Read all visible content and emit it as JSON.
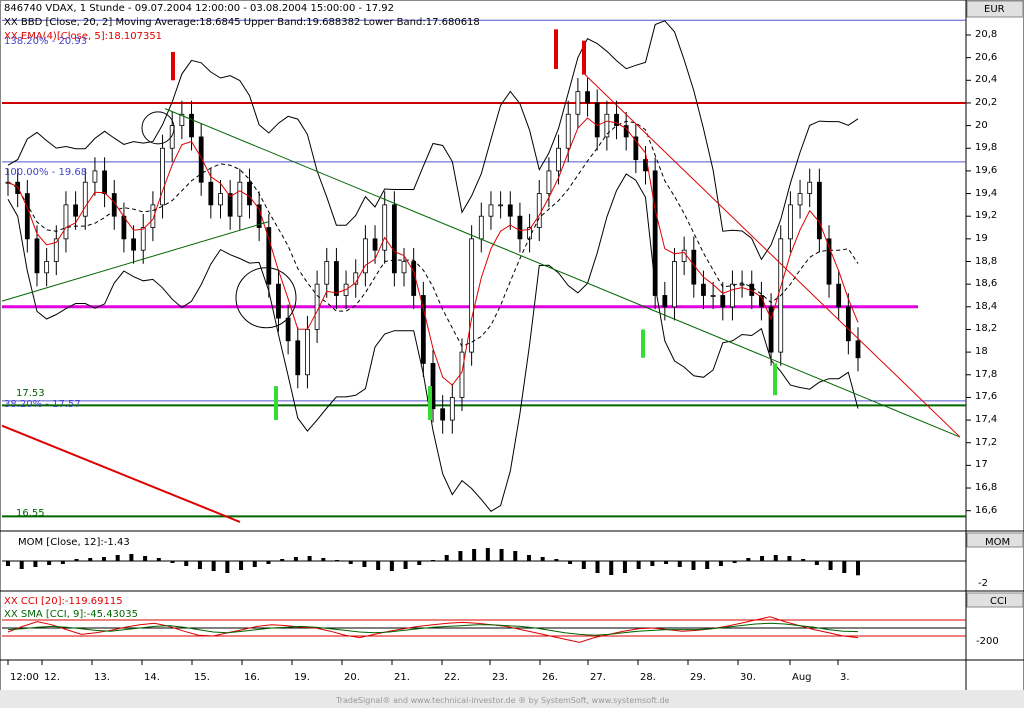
{
  "header": {
    "title": "846740  VDAX, 1 Stunde - 09.07.2004 12:00:00 - 03.08.2004 15:00:00 - 17.92",
    "bbd_label": "XX BBD [Close, 20, 2] Moving Average:18.6845 Upper Band:19.688382 Lower Band:17.680618",
    "ema_label": "XX EMA(4)[Close, 5]:18.107351",
    "currency": "EUR",
    "fib_top": "138.20% - 20.93",
    "fib_mid": "100.00% - 19.68",
    "fib_low": "38.20% - 17.57",
    "level_1753": "17.53",
    "level_1655": "16.55"
  },
  "mom_panel": {
    "label": "MOM [Close, 12]:-1.43",
    "title": "MOM",
    "tick": "-2"
  },
  "cci_panel": {
    "label1": "XX CCI [20]:-119.69115",
    "label2": "XX SMA [CCI, 9]:-45.43035",
    "title": "CCI",
    "tick": "-200"
  },
  "footer": "TradeSignal® and www.technical-investor.de ® by SystemSoft, www.systemsoft.de",
  "colors": {
    "red": "#dd0000",
    "magenta": "#e000e0",
    "green": "#006600",
    "bright_green": "#33dd33",
    "blue": "#4444cc"
  },
  "chart_data": {
    "type": "candlestick",
    "title": "846740  VDAX, 1 Stunde",
    "ylim": [
      16.5,
      20.95
    ],
    "yticks": [
      "20,8",
      "20,6",
      "20,4",
      "20,2",
      "20",
      "19,8",
      "19,6",
      "19,4",
      "19,2",
      "19",
      "18,8",
      "18,6",
      "18,4",
      "18,2",
      "18",
      "17,8",
      "17,6",
      "17,4",
      "17,2",
      "17",
      "16,8",
      "16,6"
    ],
    "x_labels": [
      "12:00",
      "12.",
      "13.",
      "14.",
      "15.",
      "16.",
      "19.",
      "20.",
      "21.",
      "22.",
      "23.",
      "26.",
      "27.",
      "28.",
      "29.",
      "30.",
      "Aug",
      "3."
    ],
    "closes": [
      19.5,
      19.4,
      19.0,
      18.7,
      18.8,
      19.0,
      19.3,
      19.2,
      19.5,
      19.6,
      19.4,
      19.2,
      19.0,
      18.9,
      19.1,
      19.3,
      19.8,
      20.0,
      20.1,
      19.9,
      19.5,
      19.3,
      19.4,
      19.2,
      19.5,
      19.3,
      19.1,
      18.6,
      18.3,
      18.1,
      17.8,
      18.2,
      18.6,
      18.8,
      18.5,
      18.6,
      18.7,
      19.0,
      18.9,
      19.3,
      18.7,
      18.8,
      18.5,
      17.9,
      17.5,
      17.4,
      17.6,
      18.0,
      19.0,
      19.2,
      19.3,
      19.3,
      19.2,
      19.0,
      19.1,
      19.4,
      19.6,
      19.8,
      20.1,
      20.3,
      20.2,
      19.9,
      20.1,
      20.0,
      19.9,
      19.7,
      19.6,
      18.5,
      18.4,
      18.8,
      18.9,
      18.6,
      18.5,
      18.5,
      18.4,
      18.6,
      18.6,
      18.5,
      18.4,
      18.0,
      19.0,
      19.3,
      19.4,
      19.5,
      19.0,
      18.6,
      18.4,
      18.1,
      17.95
    ],
    "moving_average_last": 18.6845,
    "upper_band_last": 19.688382,
    "lower_band_last": 17.680618,
    "ema_last": 18.107351,
    "horizontal_levels": [
      {
        "value": 20.93,
        "color": "blue"
      },
      {
        "value": 20.2,
        "color": "red"
      },
      {
        "value": 19.68,
        "color": "blue"
      },
      {
        "value": 18.4,
        "color": "magenta"
      },
      {
        "value": 17.57,
        "color": "blue"
      },
      {
        "value": 17.53,
        "color": "green"
      },
      {
        "value": 16.55,
        "color": "green"
      }
    ],
    "mom": [
      -0.5,
      -0.8,
      -0.6,
      -0.4,
      -0.3,
      0.2,
      0.3,
      0.4,
      0.6,
      0.7,
      0.5,
      0.3,
      -0.2,
      -0.5,
      -0.8,
      -1.0,
      -1.2,
      -0.9,
      -0.6,
      -0.3,
      0.2,
      0.4,
      0.5,
      0.3,
      0.1,
      -0.3,
      -0.6,
      -0.9,
      -1.0,
      -0.8,
      -0.4,
      0.1,
      0.6,
      1.0,
      1.2,
      1.3,
      1.2,
      1.0,
      0.6,
      0.4,
      0.2,
      -0.3,
      -0.8,
      -1.2,
      -1.4,
      -1.2,
      -0.8,
      -0.5,
      -0.3,
      -0.6,
      -0.9,
      -0.8,
      -0.5,
      -0.2,
      0.3,
      0.5,
      0.6,
      0.5,
      0.2,
      -0.4,
      -0.9,
      -1.2,
      -1.43
    ],
    "cci": [
      -50,
      20,
      80,
      40,
      -20,
      -80,
      -60,
      -30,
      10,
      40,
      60,
      20,
      -40,
      -90,
      -100,
      -60,
      -20,
      20,
      40,
      30,
      10,
      0,
      -40,
      -90,
      -120,
      -80,
      -40,
      -10,
      20,
      40,
      60,
      70,
      60,
      40,
      20,
      -20,
      -60,
      -100,
      -140,
      -180,
      -120,
      -80,
      -40,
      -10,
      0,
      -20,
      -40,
      -30,
      -10,
      20,
      60,
      100,
      140,
      80,
      30,
      -20,
      -60,
      -100,
      -119.69
    ],
    "cci_sma": [
      -20,
      -10,
      10,
      20,
      10,
      -10,
      -30,
      -40,
      -20,
      0,
      20,
      30,
      10,
      -20,
      -50,
      -60,
      -40,
      -20,
      0,
      10,
      20,
      10,
      -10,
      -30,
      -50,
      -60,
      -50,
      -30,
      -10,
      10,
      20,
      30,
      40,
      40,
      30,
      20,
      0,
      -30,
      -60,
      -80,
      -90,
      -80,
      -60,
      -40,
      -30,
      -20,
      -20,
      -20,
      -10,
      10,
      30,
      50,
      60,
      50,
      30,
      10,
      -20,
      -40,
      -45.43
    ]
  }
}
